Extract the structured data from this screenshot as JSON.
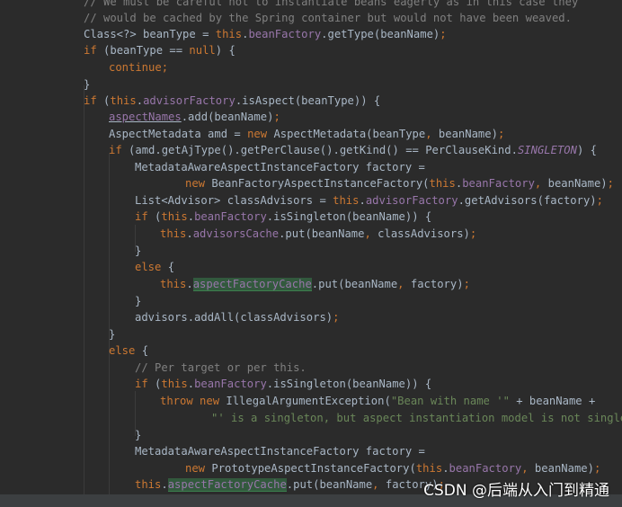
{
  "code": {
    "l0": "// We must be careful not to instantiate beans eagerly as in this case they",
    "l1": "// would be cached by the Spring container but would not have been weaved.",
    "l2": {
      "a": "Class<?> beanType = ",
      "b": "this",
      "c": ".",
      "d": "beanFactory",
      "e": ".getType(beanName)",
      "f": ";"
    },
    "l3": {
      "a": "if",
      "b": " (beanType == ",
      "c": "null",
      "d": ") {"
    },
    "l4": {
      "a": "continue;"
    },
    "l5": {
      "a": "}"
    },
    "l6": {
      "a": "if",
      "b": " (",
      "c": "this",
      "d": ".",
      "e": "advisorFactory",
      "f": ".isAspect(beanType)) {"
    },
    "l7": {
      "a": "aspectNames",
      "b": ".add(beanName)",
      "c": ";"
    },
    "l8": {
      "a": "AspectMetadata amd = ",
      "b": "new",
      "c": " AspectMetadata(beanType",
      "d": ",",
      "e": " beanName)",
      "f": ";"
    },
    "l9": {
      "a": "if",
      "b": " (amd.getAjType().getPerClause().getKind() == PerClauseKind.",
      "c": "SINGLETON",
      "d": ") {"
    },
    "l10": {
      "a": "MetadataAwareAspectInstanceFactory factory ="
    },
    "l11": {
      "a": "new",
      "b": " BeanFactoryAspectInstanceFactory(",
      "c": "this",
      "d": ".",
      "e": "beanFactory",
      "f": ",",
      "g": " beanName)",
      "h": ";"
    },
    "l12": {
      "a": "List<Advisor> classAdvisors = ",
      "b": "this",
      "c": ".",
      "d": "advisorFactory",
      "e": ".getAdvisors(factory)",
      "f": ";"
    },
    "l13": {
      "a": "if",
      "b": " (",
      "c": "this",
      "d": ".",
      "e": "beanFactory",
      "f": ".isSingleton(beanName)) {"
    },
    "l14": {
      "a": "this",
      "b": ".",
      "c": "advisorsCache",
      "d": ".put(beanName",
      "e": ",",
      "f": " classAdvisors)",
      "g": ";"
    },
    "l15": {
      "a": "}"
    },
    "l16": {
      "a": "else",
      "b": " {"
    },
    "l17": {
      "a": "this",
      "b": ".",
      "c": "aspectFactoryCache",
      "d": ".put(beanName",
      "e": ",",
      "f": " factory)",
      "g": ";"
    },
    "l18": {
      "a": "}"
    },
    "l19": {
      "a": "advisors.addAll(classAdvisors)",
      "b": ";"
    },
    "l20": {
      "a": "}"
    },
    "l21": {
      "a": "else",
      "b": " {"
    },
    "l22": {
      "a": "// Per target or per this."
    },
    "l23": {
      "a": "if",
      "b": " (",
      "c": "this",
      "d": ".",
      "e": "beanFactory",
      "f": ".isSingleton(beanName)) {"
    },
    "l24": {
      "a": "throw new",
      "b": " IllegalArgumentException(",
      "c": "\"Bean with name '\"",
      "d": " + beanName +"
    },
    "l25": {
      "a": "\"' is a singleton, but aspect instantiation model is not singleton"
    },
    "l26": {
      "a": "}"
    },
    "l27": {
      "a": "MetadataAwareAspectInstanceFactory factory ="
    },
    "l28": {
      "a": "new",
      "b": " PrototypeAspectInstanceFactory(",
      "c": "this",
      "d": ".",
      "e": "beanFactory",
      "f": ",",
      "g": " beanName)",
      "h": ";"
    },
    "l29": {
      "a": "this",
      "b": ".",
      "c": "aspectFactoryCache",
      "d": ".put(beanName",
      "e": ",",
      "f": " factory)",
      "g": ";"
    }
  },
  "watermark": "CSDN @后端从入门到精通"
}
